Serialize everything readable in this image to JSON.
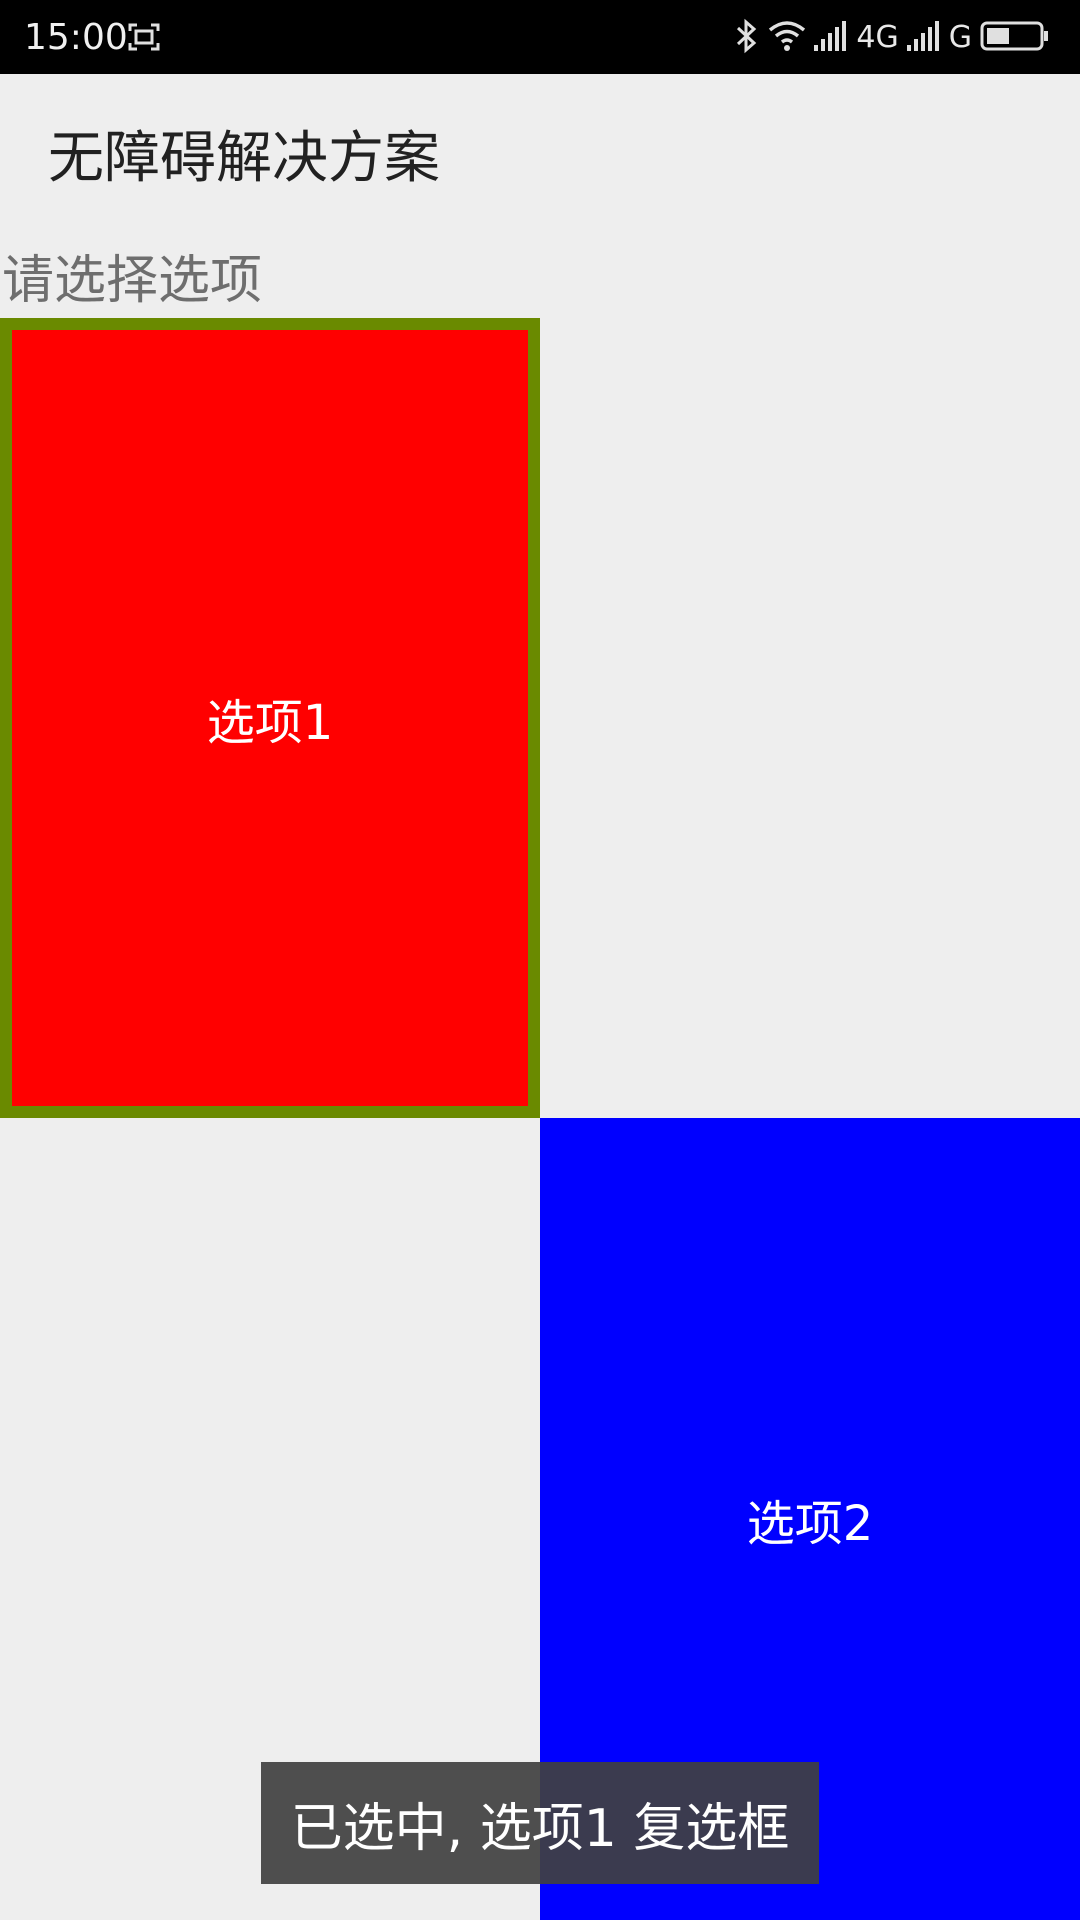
{
  "status_bar": {
    "time": "15:00",
    "network_1": "4G",
    "network_2": "G",
    "icons": [
      "screenshot-icon",
      "bluetooth-icon",
      "wifi-icon",
      "signal-icon",
      "signal-icon",
      "battery-icon"
    ],
    "battery_level": 0.4
  },
  "app": {
    "title": "无障碍解决方案",
    "prompt": "请选择选项"
  },
  "options": [
    {
      "label": "选项1",
      "color": "#ff0000",
      "selected": true,
      "focus_border_color": "#6a8a00"
    },
    {
      "label": "选项2",
      "color": "#0000ff",
      "selected": false
    }
  ],
  "toast": {
    "message": "已选中, 选项1 复选框"
  }
}
